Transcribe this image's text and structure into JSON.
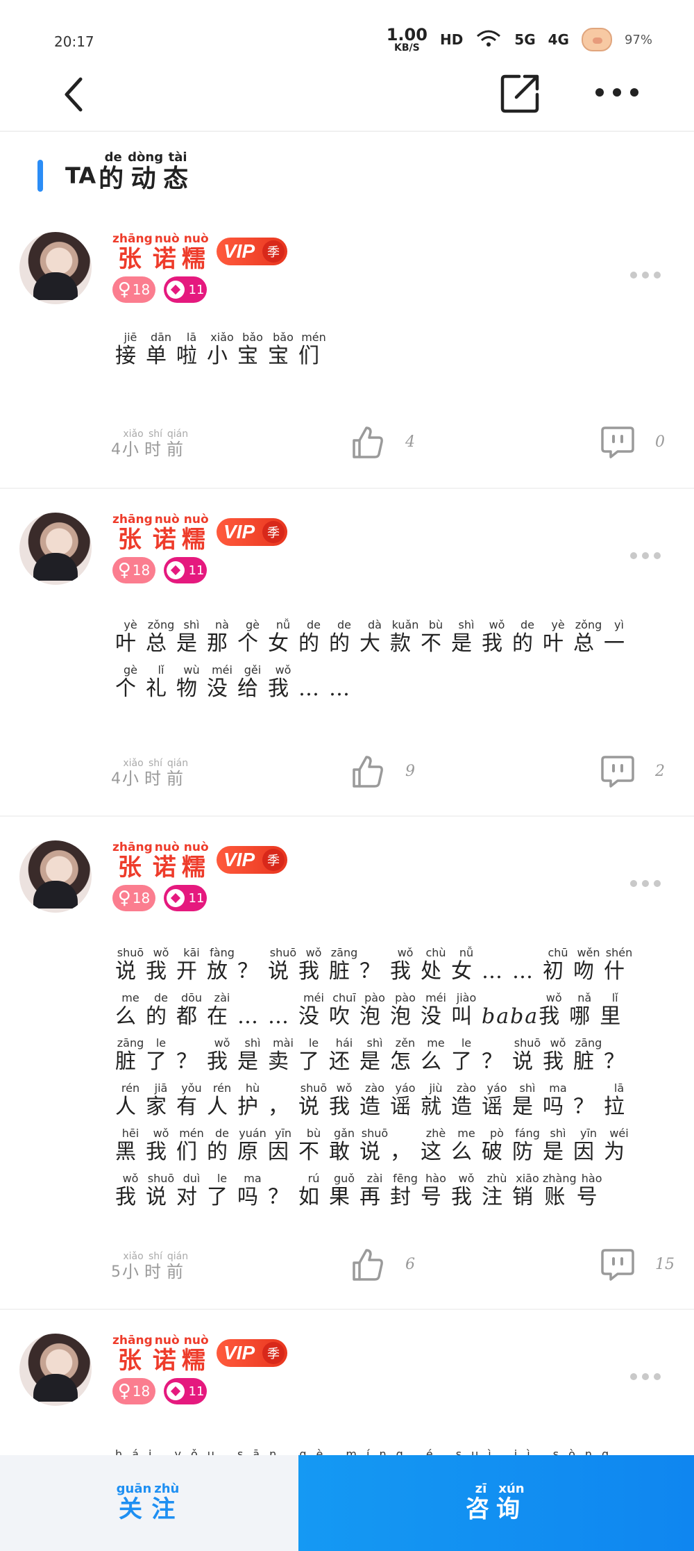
{
  "status_bar": {
    "time": "20:17",
    "net_speed": "1.00",
    "net_unit": "KB/S",
    "hd_label": "HD",
    "signal_5g": "5G",
    "signal_4g": "4G",
    "battery": "97%"
  },
  "header": {
    "back_icon": "chevron-left-icon",
    "share_icon": "share-icon",
    "more_icon": "more-horizontal-icon"
  },
  "section": {
    "prefix": "TA",
    "title_chars": [
      {
        "char": "的",
        "pinyin": "de"
      },
      {
        "char": "动",
        "pinyin": "dòng"
      },
      {
        "char": "态",
        "pinyin": "tài"
      }
    ]
  },
  "user": {
    "name_chars": [
      {
        "char": "张",
        "pinyin": "zhāng"
      },
      {
        "char": "诺",
        "pinyin": "nuò"
      },
      {
        "char": "糯",
        "pinyin": "nuò"
      }
    ],
    "vip_label": "VIP",
    "vip_season": "季",
    "gender_symbol": "♀",
    "age": "18",
    "level": "11"
  },
  "posts": [
    {
      "text_lines": [
        [
          {
            "c": "接",
            "p": "jiē"
          },
          {
            "c": "单",
            "p": "dān"
          },
          {
            "c": "啦",
            "p": "lā"
          },
          {
            "c": "小",
            "p": "xiǎo"
          },
          {
            "c": "宝",
            "p": "bǎo"
          },
          {
            "c": "宝",
            "p": "bǎo"
          },
          {
            "c": "们",
            "p": "mén"
          }
        ]
      ],
      "time_num": "4",
      "time_chars": [
        {
          "c": "小",
          "p": "xiǎo"
        },
        {
          "c": "时",
          "p": "shí"
        },
        {
          "c": "前",
          "p": "qián"
        }
      ],
      "likes": "4",
      "comments": "0"
    },
    {
      "text_lines": [
        [
          {
            "c": "叶",
            "p": "yè"
          },
          {
            "c": "总",
            "p": "zǒng"
          },
          {
            "c": "是",
            "p": "shì"
          },
          {
            "c": "那",
            "p": "nà"
          },
          {
            "c": "个",
            "p": "gè"
          },
          {
            "c": "女",
            "p": "nǚ"
          },
          {
            "c": "的",
            "p": "de"
          },
          {
            "c": "的",
            "p": "de"
          },
          {
            "c": "大",
            "p": "dà"
          },
          {
            "c": "款",
            "p": "kuǎn"
          },
          {
            "c": "不",
            "p": "bù"
          },
          {
            "c": "是",
            "p": "shì"
          },
          {
            "c": "我",
            "p": "wǒ"
          },
          {
            "c": "的",
            "p": "de"
          },
          {
            "c": "叶",
            "p": "yè"
          },
          {
            "c": "总",
            "p": "zǒng"
          },
          {
            "c": "一",
            "p": "yì"
          }
        ],
        [
          {
            "c": "个",
            "p": "gè"
          },
          {
            "c": "礼",
            "p": "lǐ"
          },
          {
            "c": "物",
            "p": "wù"
          },
          {
            "c": "没",
            "p": "méi"
          },
          {
            "c": "给",
            "p": "gěi"
          },
          {
            "c": "我",
            "p": "wǒ"
          },
          {
            "c": "…",
            "p": ""
          },
          {
            "c": "…",
            "p": ""
          }
        ]
      ],
      "time_num": "4",
      "time_chars": [
        {
          "c": "小",
          "p": "xiǎo"
        },
        {
          "c": "时",
          "p": "shí"
        },
        {
          "c": "前",
          "p": "qián"
        }
      ],
      "likes": "9",
      "comments": "2"
    },
    {
      "text_lines": [
        [
          {
            "c": "说",
            "p": "shuō"
          },
          {
            "c": "我",
            "p": "wǒ"
          },
          {
            "c": "开",
            "p": "kāi"
          },
          {
            "c": "放",
            "p": "fàng"
          },
          {
            "c": "？",
            "p": ""
          },
          {
            "c": "说",
            "p": "shuō"
          },
          {
            "c": "我",
            "p": "wǒ"
          },
          {
            "c": "脏",
            "p": "zāng"
          },
          {
            "c": "？",
            "p": ""
          },
          {
            "c": "我",
            "p": "wǒ"
          },
          {
            "c": "处",
            "p": "chù"
          },
          {
            "c": "女",
            "p": "nǚ"
          },
          {
            "c": "…",
            "p": ""
          },
          {
            "c": "…",
            "p": ""
          },
          {
            "c": "初",
            "p": "chū"
          },
          {
            "c": "吻",
            "p": "wěn"
          },
          {
            "c": "什",
            "p": "shén"
          }
        ],
        [
          {
            "c": "么",
            "p": "me"
          },
          {
            "c": "的",
            "p": "de"
          },
          {
            "c": "都",
            "p": "dōu"
          },
          {
            "c": "在",
            "p": "zài"
          },
          {
            "c": "…",
            "p": ""
          },
          {
            "c": "…",
            "p": ""
          },
          {
            "c": "没",
            "p": "méi"
          },
          {
            "c": "吹",
            "p": "chuī"
          },
          {
            "c": "泡",
            "p": "pào"
          },
          {
            "c": "泡",
            "p": "pào"
          },
          {
            "c": "没",
            "p": "méi"
          },
          {
            "c": "叫",
            "p": "jiào"
          },
          {
            "c": "baba",
            "p": ""
          },
          {
            "c": "我",
            "p": "wǒ"
          },
          {
            "c": "哪",
            "p": "nǎ"
          },
          {
            "c": "里",
            "p": "lǐ"
          }
        ],
        [
          {
            "c": "脏",
            "p": "zāng"
          },
          {
            "c": "了",
            "p": "le"
          },
          {
            "c": "？",
            "p": ""
          },
          {
            "c": "我",
            "p": "wǒ"
          },
          {
            "c": "是",
            "p": "shì"
          },
          {
            "c": "卖",
            "p": "mài"
          },
          {
            "c": "了",
            "p": "le"
          },
          {
            "c": "还",
            "p": "hái"
          },
          {
            "c": "是",
            "p": "shì"
          },
          {
            "c": "怎",
            "p": "zěn"
          },
          {
            "c": "么",
            "p": "me"
          },
          {
            "c": "了",
            "p": "le"
          },
          {
            "c": "？",
            "p": ""
          },
          {
            "c": "说",
            "p": "shuō"
          },
          {
            "c": "我",
            "p": "wǒ"
          },
          {
            "c": "脏",
            "p": "zāng"
          },
          {
            "c": "？",
            "p": ""
          }
        ],
        [
          {
            "c": "人",
            "p": "rén"
          },
          {
            "c": "家",
            "p": "jiā"
          },
          {
            "c": "有",
            "p": "yǒu"
          },
          {
            "c": "人",
            "p": "rén"
          },
          {
            "c": "护",
            "p": "hù"
          },
          {
            "c": "，",
            "p": ""
          },
          {
            "c": "说",
            "p": "shuō"
          },
          {
            "c": "我",
            "p": "wǒ"
          },
          {
            "c": "造",
            "p": "zào"
          },
          {
            "c": "谣",
            "p": "yáo"
          },
          {
            "c": "就",
            "p": "jiù"
          },
          {
            "c": "造",
            "p": "zào"
          },
          {
            "c": "谣",
            "p": "yáo"
          },
          {
            "c": "是",
            "p": "shì"
          },
          {
            "c": "吗",
            "p": "ma"
          },
          {
            "c": "？",
            "p": ""
          },
          {
            "c": "拉",
            "p": "lā"
          }
        ],
        [
          {
            "c": "黑",
            "p": "hēi"
          },
          {
            "c": "我",
            "p": "wǒ"
          },
          {
            "c": "们",
            "p": "mén"
          },
          {
            "c": "的",
            "p": "de"
          },
          {
            "c": "原",
            "p": "yuán"
          },
          {
            "c": "因",
            "p": "yīn"
          },
          {
            "c": "不",
            "p": "bù"
          },
          {
            "c": "敢",
            "p": "gǎn"
          },
          {
            "c": "说",
            "p": "shuō"
          },
          {
            "c": "，",
            "p": ""
          },
          {
            "c": "这",
            "p": "zhè"
          },
          {
            "c": "么",
            "p": "me"
          },
          {
            "c": "破",
            "p": "pò"
          },
          {
            "c": "防",
            "p": "fáng"
          },
          {
            "c": "是",
            "p": "shì"
          },
          {
            "c": "因",
            "p": "yīn"
          },
          {
            "c": "为",
            "p": "wéi"
          }
        ],
        [
          {
            "c": "我",
            "p": "wǒ"
          },
          {
            "c": "说",
            "p": "shuō"
          },
          {
            "c": "对",
            "p": "duì"
          },
          {
            "c": "了",
            "p": "le"
          },
          {
            "c": "吗",
            "p": "ma"
          },
          {
            "c": "？",
            "p": ""
          },
          {
            "c": "如",
            "p": "rú"
          },
          {
            "c": "果",
            "p": "guǒ"
          },
          {
            "c": "再",
            "p": "zài"
          },
          {
            "c": "封",
            "p": "fēng"
          },
          {
            "c": "号",
            "p": "hào"
          },
          {
            "c": "我",
            "p": "wǒ"
          },
          {
            "c": "注",
            "p": "zhù"
          },
          {
            "c": "销",
            "p": "xiāo"
          },
          {
            "c": "账",
            "p": "zhàng"
          },
          {
            "c": "号",
            "p": "hào"
          }
        ]
      ],
      "time_num": "5",
      "time_chars": [
        {
          "c": "小",
          "p": "xiǎo"
        },
        {
          "c": "时",
          "p": "shí"
        },
        {
          "c": "前",
          "p": "qián"
        }
      ],
      "likes": "6",
      "comments": "15"
    }
  ],
  "peek_pinyin": "hái  yǒu  sān  gè  míng  é  suì  jì  sòng",
  "bottom": {
    "follow_chars": [
      {
        "c": "关",
        "p": "guān"
      },
      {
        "c": "注",
        "p": "zhù"
      }
    ],
    "consult_chars": [
      {
        "c": "咨",
        "p": "zī"
      },
      {
        "c": "询",
        "p": "xún"
      }
    ]
  },
  "colors": {
    "accent": "#2b8df6",
    "name_red": "#ee3b2a",
    "vip": "#e8361f",
    "gender_pink": "#fb7d8f",
    "level_magenta": "#e5197e",
    "consult_blue": "#1599f3"
  }
}
